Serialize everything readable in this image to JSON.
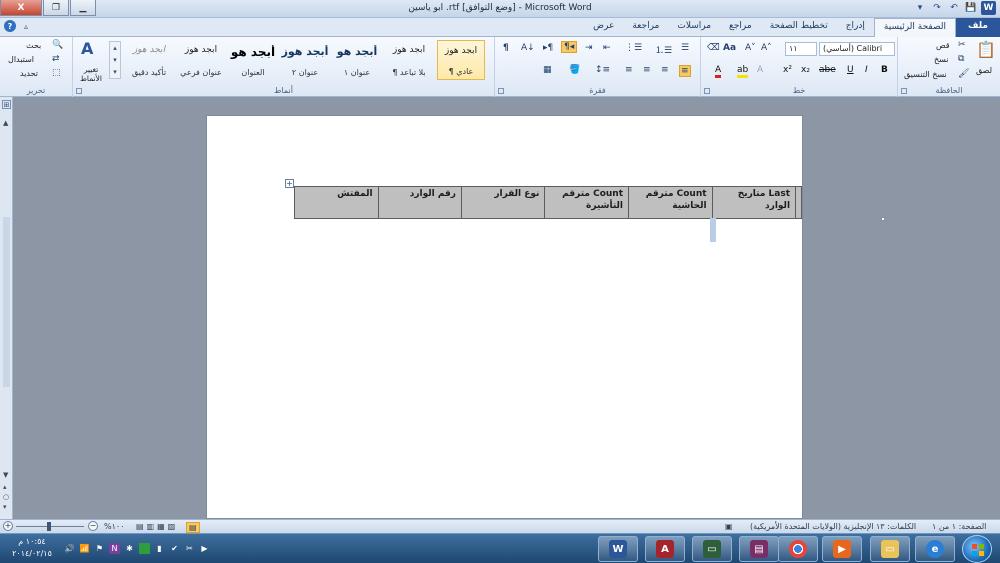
{
  "window": {
    "title": "ابو ياسين .rtf [وضع التوافق] - Microsoft Word",
    "minimize": "▁",
    "restore": "❐",
    "close": "X"
  },
  "qat": {
    "word_icon": "W",
    "save": "💾",
    "undo": "↶",
    "redo": "↷",
    "more": "▾"
  },
  "tabs": [
    "ملف",
    "الصفحة الرئيسية",
    "إدراج",
    "تخطيط الصفحة",
    "مراجع",
    "مراسلات",
    "مراجعة",
    "عرض"
  ],
  "tabs_right_icons": {
    "help": "?",
    "caret": "▵"
  },
  "ribbon": {
    "clipboard": {
      "label": "الحافظة",
      "paste": "لصق",
      "cut": "قص",
      "copy": "نسخ",
      "format_painter": "نسخ التنسيق"
    },
    "font": {
      "label": "خط",
      "font_name": "(أساسي) Calibri",
      "font_size": "١١",
      "bold": "B",
      "italic": "I",
      "underline": "U",
      "strike": "abe",
      "subscript": "x₂",
      "superscript": "x²",
      "grow": "A˄",
      "shrink": "A˅",
      "change_case": "Aa",
      "font_color": "A",
      "highlight": "ab"
    },
    "paragraph": {
      "label": "فقرة"
    },
    "styles": {
      "label": "أنماط",
      "items": [
        {
          "preview": "أبجد هوز",
          "name": "¶ عادي"
        },
        {
          "preview": "أبجد هوز",
          "name": "¶ بلا تباعد"
        },
        {
          "preview": "أبجد هو",
          "name": "عنوان ١"
        },
        {
          "preview": "أبجد هوز",
          "name": "عنوان ٢"
        },
        {
          "preview": "أبجد هو",
          "name": "العنوان"
        },
        {
          "preview": "أبجد هوز",
          "name": "عنوان فرعي"
        },
        {
          "preview": "أبجد هوز",
          "name": "تأكيد دقيق"
        }
      ],
      "change_styles": "تغيير الأنماط"
    },
    "editing": {
      "label": "تحرير",
      "find": "بحث",
      "replace": "استبدال",
      "select": "تحديد"
    }
  },
  "document": {
    "table_headers": [
      "متاريخ Last الوارد",
      "مترقم Count الحاشية",
      "مترقم Count التأشيرة",
      "نوع القرار",
      "رقم الوارد",
      "المفتش"
    ]
  },
  "statusbar": {
    "page": "الصفحة: ١ من ١",
    "words": "الكلمات: ١٣",
    "language": "الإنجليزية (الولايات المتحدة الأمريكية)",
    "zoom": "%١٠٠"
  },
  "taskbar": {
    "time": "١٠:٥٤ م",
    "date": "٢٠١٤/٠٢/١٥"
  }
}
